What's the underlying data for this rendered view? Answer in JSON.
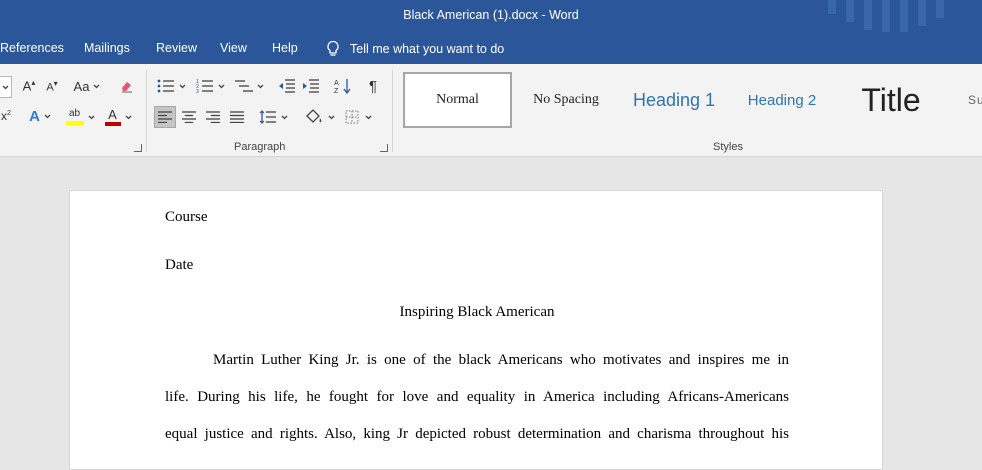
{
  "window": {
    "title": "Black American (1).docx  -  Word"
  },
  "menu": {
    "tabs": [
      "References",
      "Mailings",
      "Review",
      "View",
      "Help"
    ],
    "tell_me": "Tell me what you want to do"
  },
  "ribbon": {
    "font_group": {
      "change_case": "Aa"
    },
    "paragraph_group": {
      "label": "Paragraph"
    },
    "styles_group": {
      "label": "Styles",
      "items": [
        "Normal",
        "No Spacing",
        "Heading 1",
        "Heading 2",
        "Title",
        "Su"
      ],
      "selected": "Normal"
    }
  },
  "document": {
    "lines": [
      "Course",
      "Date",
      "Inspiring Black American",
      "Martin Luther King Jr. is one of the black Americans who motivates and inspires me in",
      "life. During his life, he fought for love and equality in America including Africans-Americans",
      "equal justice and rights. Also, king Jr depicted robust determination and charisma throughout his"
    ]
  },
  "colors": {
    "titlebar": "#2b579a",
    "ribbon": "#f3f3f3",
    "canvas": "#e6e6e6",
    "heading": "#2e74b5",
    "font_color": "#c00000",
    "highlight": "#ffff00"
  }
}
